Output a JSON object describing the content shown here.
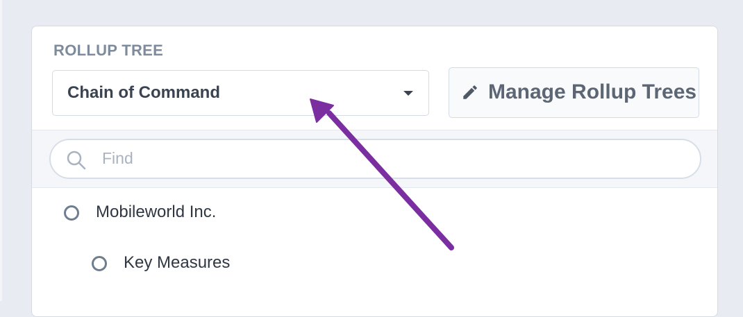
{
  "rollup": {
    "section_label": "ROLLUP TREE",
    "selected_tree": "Chain of Command",
    "manage_button_label": "Manage Rollup Trees"
  },
  "search": {
    "placeholder": "Find"
  },
  "tree": {
    "items": [
      {
        "label": "Mobileworld Inc.",
        "level": 0
      },
      {
        "label": "Key Measures",
        "level": 1
      }
    ]
  },
  "annotation": {
    "arrow_color": "#7a2ea0"
  },
  "icons": {
    "select_caret": "caret-down-icon",
    "manage": "pencil-icon",
    "search": "search-icon",
    "tree_item": "radio-icon"
  }
}
